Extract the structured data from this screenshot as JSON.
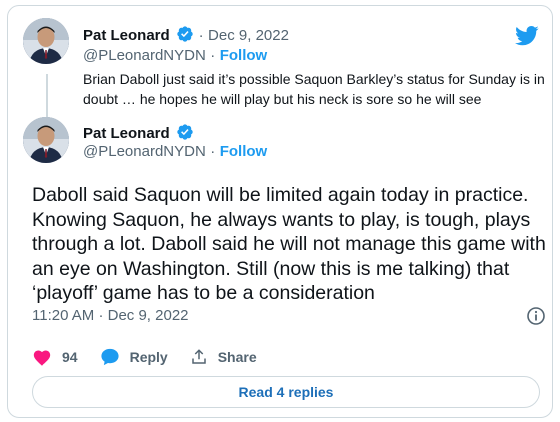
{
  "quoted_tweet": {
    "author_name": "Pat Leonard",
    "date": "Dec 9, 2022",
    "handle": "@PLeonardNYDN",
    "follow_label": "Follow",
    "text": "Brian Daboll just said it’s possible Saquon Barkley’s status for Sunday is in doubt … he hopes he will play but his neck is sore so he will see"
  },
  "main_tweet": {
    "author_name": "Pat Leonard",
    "handle": "@PLeonardNYDN",
    "follow_label": "Follow",
    "text": "Daboll said Saquon will be limited again today in practice. Knowing Saquon, he always wants to play, is tough, plays through a lot. Daboll said he will not manage this game with an eye on Washington. Still (now this is me talking) that ‘playoff’ game has to be a consideration",
    "time": "11:20 AM",
    "date": "Dec 9, 2022"
  },
  "actions": {
    "like_count": "94",
    "reply_label": "Reply",
    "share_label": "Share"
  },
  "read_replies_label": "Read 4 replies",
  "separator": "·",
  "colors": {
    "accent": "#1d9bf0",
    "like": "#f91880",
    "text": "#0f1419",
    "muted": "#536471",
    "border": "#cfd9de"
  },
  "icons": {
    "brand": "twitter-bird-icon",
    "verified": "verified-badge-icon",
    "like": "heart-icon",
    "reply": "speech-bubble-icon",
    "share": "share-upload-icon",
    "info": "info-icon"
  }
}
